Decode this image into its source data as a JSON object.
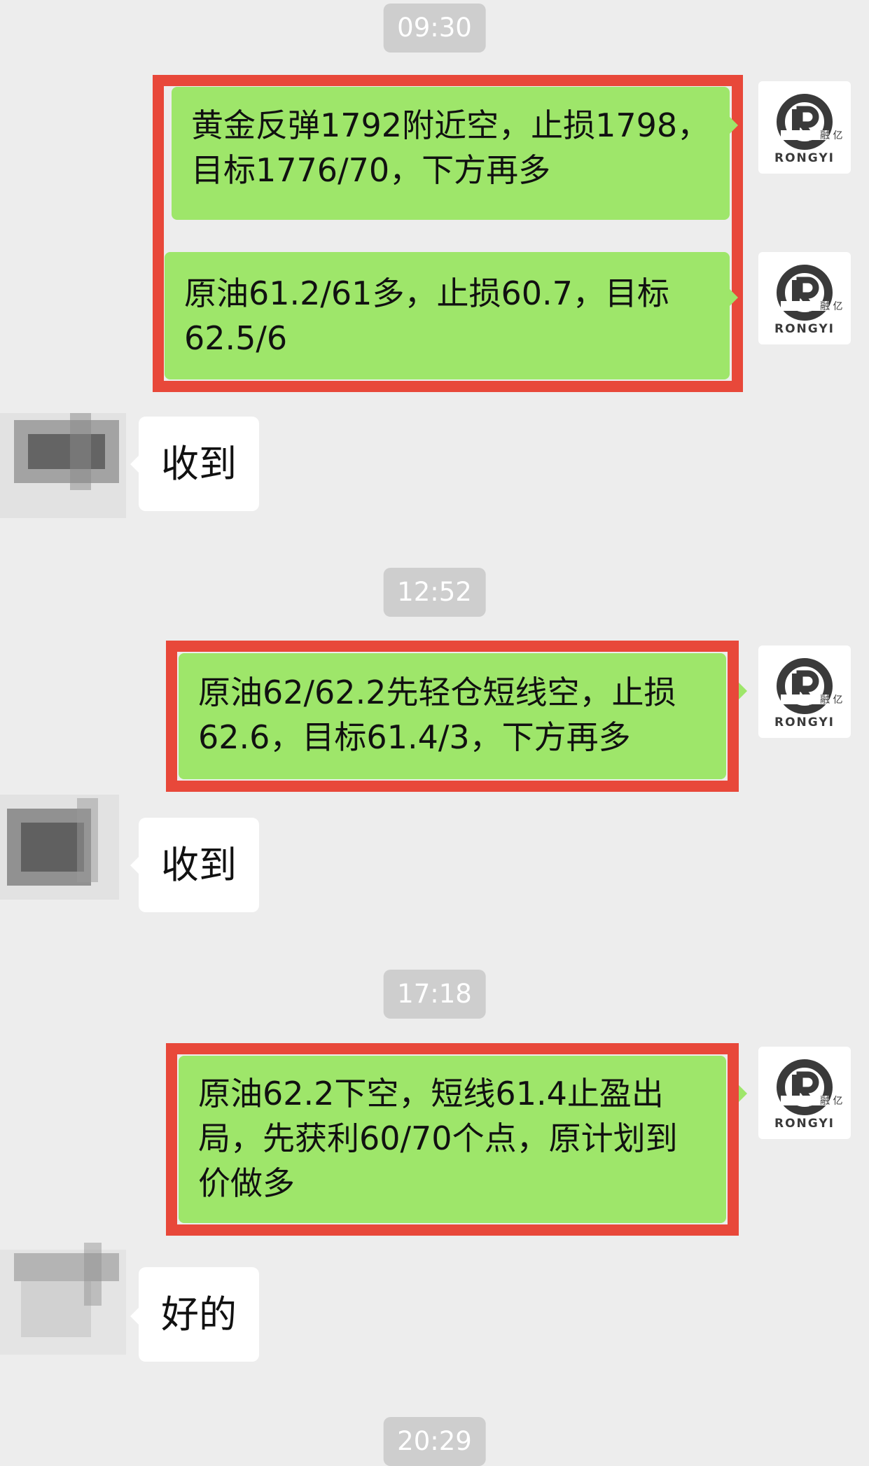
{
  "timestamps": [
    "09:30",
    "12:52",
    "17:18",
    "20:29"
  ],
  "sent_messages": [
    "黄金反弹1792附近空，止损1798，目标1776/70，下方再多",
    "原油61.2/61多，止损60.7，目标62.5/6",
    "原油62/62.2先轻仓短线空，止损62.6，目标61.4/3，下方再多",
    "原油62.2下空，短线61.4止盈出局，先获利60/70个点，原计划到价做多"
  ],
  "received_messages": [
    "收到",
    "收到",
    "好的"
  ],
  "sender_avatar": {
    "brand_cn": "融 亿",
    "brand_en": "RONGYI"
  },
  "colors": {
    "background": "#ededed",
    "sent_bubble": "#9ee66a",
    "received_bubble": "#ffffff",
    "highlight_border": "#e8483a",
    "timestamp_bg": "#cecece"
  }
}
